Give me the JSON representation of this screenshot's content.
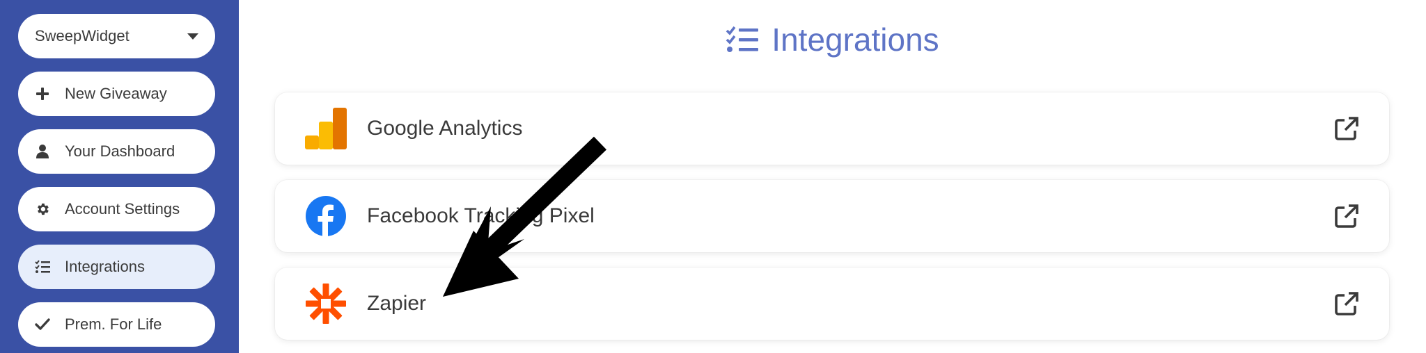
{
  "sidebar": {
    "select": {
      "value": "SweepWidget"
    },
    "items": [
      {
        "label": "New Giveaway",
        "icon": "plus-icon"
      },
      {
        "label": "Your Dashboard",
        "icon": "user-icon"
      },
      {
        "label": "Account Settings",
        "icon": "gear-icon"
      },
      {
        "label": "Integrations",
        "icon": "list-check-icon",
        "active": true
      },
      {
        "label": "Prem. For Life",
        "icon": "check-icon"
      }
    ]
  },
  "main": {
    "title": "Integrations",
    "title_icon": "list-check-icon",
    "integrations": [
      {
        "label": "Google Analytics",
        "logo": "google-analytics-logo",
        "action_icon": "external-link-icon"
      },
      {
        "label": "Facebook Tracking Pixel",
        "logo": "facebook-logo",
        "action_icon": "external-link-icon"
      },
      {
        "label": "Zapier",
        "logo": "zapier-logo",
        "action_icon": "external-link-icon"
      }
    ]
  },
  "colors": {
    "sidebar_bg": "#3a51a5",
    "title": "#5e74c6",
    "active_pill": "#e7eefb",
    "ga_yellow": "#f9ab00",
    "ga_orange": "#e37400",
    "facebook_blue": "#1877f2",
    "zapier_orange": "#ff4f00"
  }
}
